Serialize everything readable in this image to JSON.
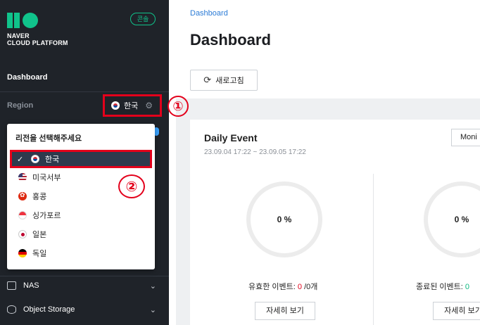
{
  "sidebar": {
    "logo_line1": "NAVER",
    "logo_line2": "CLOUD PLATFORM",
    "console_badge": "콘솔",
    "dashboard": "Dashboard",
    "region_label": "Region",
    "region_value": "한국",
    "nav_items": [
      {
        "label": "NAS",
        "icon": "nas-icon"
      },
      {
        "label": "Object Storage",
        "icon": "object-storage-icon"
      }
    ]
  },
  "region_dropdown": {
    "title": "리전을 선택해주세요",
    "options": [
      {
        "label": "한국",
        "flag": "kr",
        "selected": true
      },
      {
        "label": "미국서부",
        "flag": "us",
        "selected": false
      },
      {
        "label": "홍콩",
        "flag": "hk",
        "selected": false
      },
      {
        "label": "싱가포르",
        "flag": "sg",
        "selected": false
      },
      {
        "label": "일본",
        "flag": "jp",
        "selected": false
      },
      {
        "label": "독일",
        "flag": "de",
        "selected": false
      }
    ]
  },
  "annotations": {
    "step1": "①",
    "step2": "②",
    "highlight_color": "#e3001b"
  },
  "main": {
    "breadcrumb": "Dashboard",
    "title": "Dashboard",
    "refresh_label": "새로고침",
    "card": {
      "title": "Daily Event",
      "range": "23.09.04 17:22 ~ 23.09.05 17:22",
      "monitor_label": "Moni",
      "left": {
        "percent": "0 %",
        "label": "유효한 이벤트: ",
        "count": "0",
        "total": " /0개",
        "detail": "자세히 보기"
      },
      "right": {
        "percent": "0 %",
        "label": "종료된 이벤트: ",
        "count": "0",
        "detail": "자세히 보기"
      }
    }
  },
  "colors": {
    "accent": "#10c38b",
    "sidebar_bg": "#1f2329",
    "link": "#2b7bd6"
  }
}
